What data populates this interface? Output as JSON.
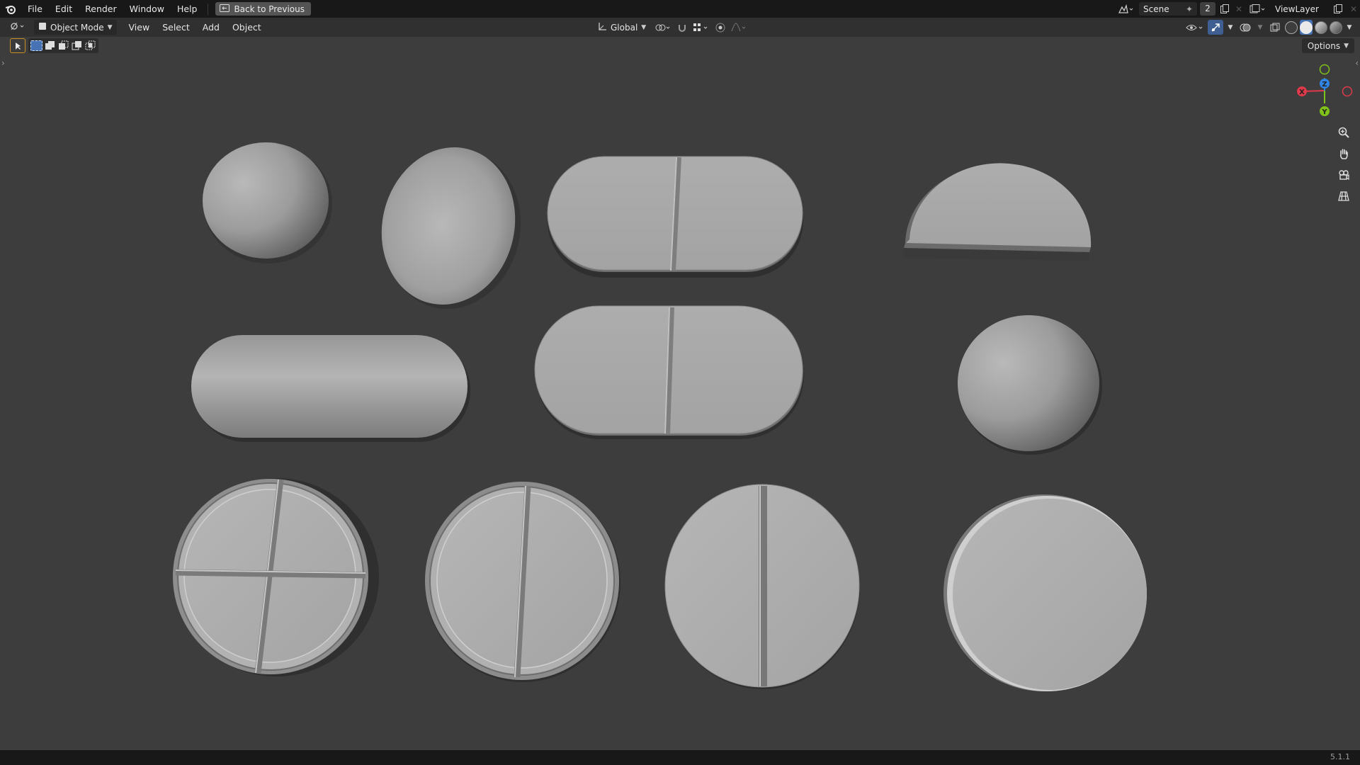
{
  "topbar": {
    "menus": [
      "File",
      "Edit",
      "Render",
      "Window",
      "Help"
    ],
    "back_label": "Back to Previous",
    "scene_name": "Scene",
    "users_count": "2",
    "view_layer": "ViewLayer"
  },
  "viewport_header": {
    "mode": "Object Mode",
    "menus": [
      "View",
      "Select",
      "Add",
      "Object"
    ],
    "orientation": "Global"
  },
  "viewport": {
    "options_label": "Options",
    "gizmo": {
      "x_label": "X",
      "y_label": "Y",
      "z_label": "Z"
    },
    "pills": [
      {
        "name": "round-ball"
      },
      {
        "name": "oval-ball"
      },
      {
        "name": "scored-capsule-tablet-top"
      },
      {
        "name": "half-round-tablet"
      },
      {
        "name": "capsule"
      },
      {
        "name": "scored-capsule-tablet-middle"
      },
      {
        "name": "dome-tablet"
      },
      {
        "name": "cross-scored-round-tablet"
      },
      {
        "name": "single-scored-round-tablet-beveled"
      },
      {
        "name": "single-scored-round-tablet-flat"
      },
      {
        "name": "plain-round-tablet"
      }
    ]
  },
  "colors": {
    "accent_orange": "#c98f22",
    "axis_x": "#e0394b",
    "axis_y": "#80c21a",
    "axis_z": "#2f86e6",
    "background": "#3d3d3d"
  },
  "statusbar": {
    "version": "5.1.1"
  }
}
